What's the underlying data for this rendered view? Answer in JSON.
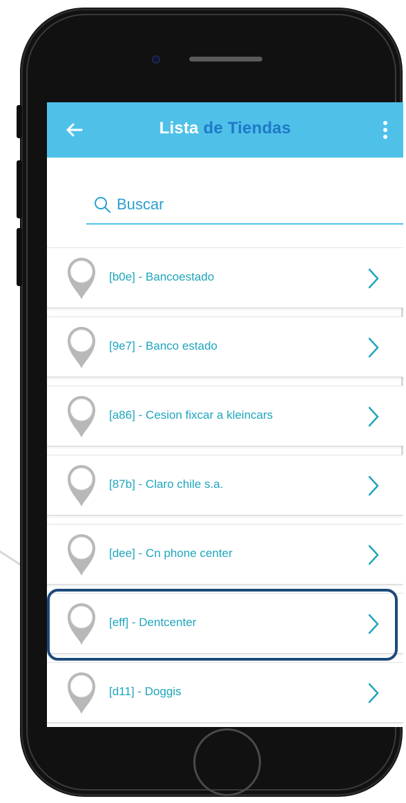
{
  "appbar": {
    "title_part1": "Lista",
    "title_part2": "de Tiendas",
    "back_icon": "arrow-left-icon",
    "menu_icon": "more-vertical-icon",
    "color": "#4fc1e9",
    "title_accent_color": "#1f78c8"
  },
  "search": {
    "placeholder": "Buscar",
    "value": "",
    "icon": "search-icon"
  },
  "stores": [
    {
      "label": "[b0e] - Bancoestado",
      "highlighted": false
    },
    {
      "label": "[9e7] - Banco estado",
      "highlighted": false
    },
    {
      "label": "[a86] - Cesion fixcar a kleincars",
      "highlighted": false
    },
    {
      "label": "[87b] - Claro chile s.a.",
      "highlighted": false
    },
    {
      "label": "[dee] - Cn phone center",
      "highlighted": false
    },
    {
      "label": "[eff] - Dentcenter",
      "highlighted": true
    },
    {
      "label": "[d11] - Doggis",
      "highlighted": false
    }
  ],
  "colors": {
    "item_text": "#1ea5bd",
    "highlight_border": "#1d4a7a",
    "pin": "#b8b8b8"
  }
}
